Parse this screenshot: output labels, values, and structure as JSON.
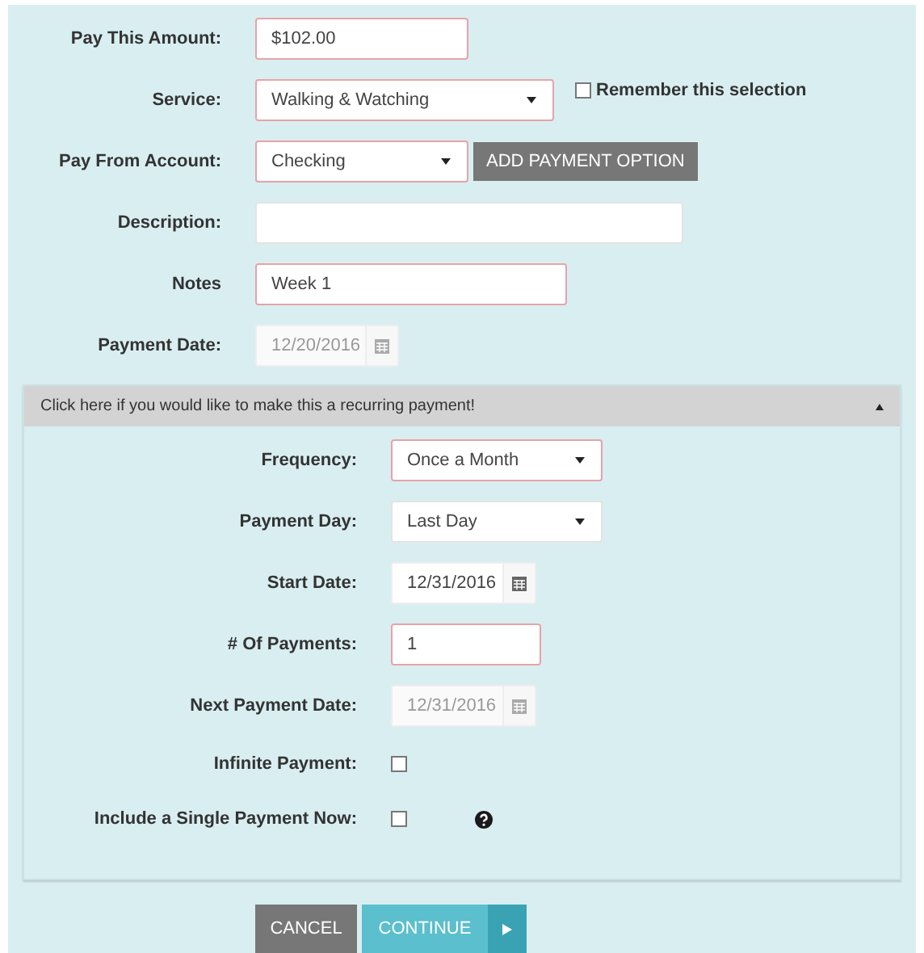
{
  "form": {
    "rows": [
      {
        "label": "Pay This Amount:",
        "kind": "text",
        "value": "$102.00",
        "required": true
      },
      {
        "label": "Service:",
        "kind": "select",
        "value": "Walking & Watching",
        "required": true,
        "remember": {
          "label": "Remember this selection",
          "checked": false
        }
      },
      {
        "label": "Pay From Account:",
        "kind": "select",
        "value": "Checking",
        "required": true,
        "button": "ADD PAYMENT OPTION"
      },
      {
        "label": "Description:",
        "kind": "text",
        "required": false
      },
      {
        "label": "Notes",
        "kind": "text",
        "value": "Week 1",
        "required": true
      },
      {
        "label": "Payment Date:",
        "kind": "date",
        "value": "12/20/2016",
        "disabled": true
      }
    ]
  },
  "recurring": {
    "header": "Click here if you would like to make this a recurring payment!",
    "expanded": true,
    "rows": [
      {
        "label": "Frequency:",
        "kind": "select",
        "value": "Once a Month",
        "required": true
      },
      {
        "label": "Payment Day:",
        "kind": "select",
        "value": "Last Day",
        "required": false
      },
      {
        "label": "Start Date:",
        "kind": "date",
        "value": "12/31/2016",
        "disabled": false
      },
      {
        "label": "# Of Payments:",
        "kind": "text",
        "value": "1",
        "required": true
      },
      {
        "label": "Next Payment Date:",
        "kind": "date",
        "value": "12/31/2016",
        "disabled": true
      },
      {
        "label": "Infinite Payment:",
        "kind": "checkbox",
        "checked": false
      },
      {
        "label": "Include a Single Payment Now:",
        "kind": "checkbox",
        "checked": false,
        "help": true
      }
    ]
  },
  "buttons": [
    {
      "label": "CANCEL",
      "kind": "cancel"
    },
    {
      "label": "CONTINUE",
      "kind": "continue"
    }
  ]
}
